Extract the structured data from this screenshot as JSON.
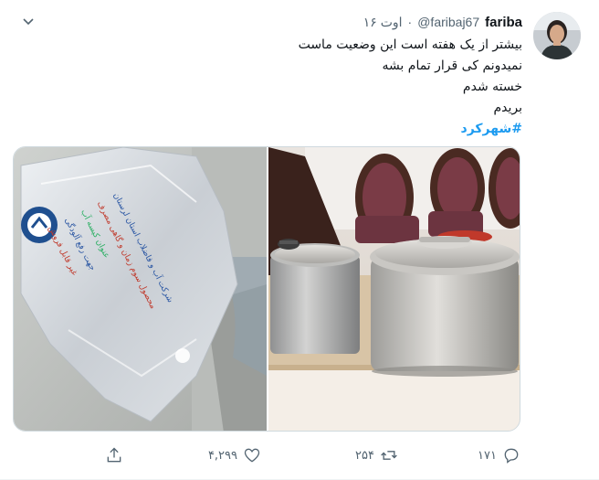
{
  "author": {
    "display_name": "fariba",
    "handle": "@faribaj67",
    "separator": "·",
    "date": "۱۶ اوت"
  },
  "tweet": {
    "lines": [
      "بیشتر از یک هفته است این وضعیت ماست",
      "نمیدونم کی قرار تمام بشه",
      "خسته شدم",
      "بریدم"
    ],
    "hashtag": "#شهرکرد"
  },
  "media": {
    "left_image": "water-bag-photo",
    "right_image": "cooking-pots-photo",
    "bag_text_lines": [
      "شرکت آب و فاضلاب استان لرستان",
      "محصول سوم زمان و گاهی مصرف",
      "عنوان کیسه آب",
      "جهت رفع آلودگی",
      "غیر قابل فروش"
    ]
  },
  "actions": {
    "reply_count": "۱۷۱",
    "retweet_count": "۲۵۴",
    "like_count": "۴,۲۹۹",
    "reply_icon": "reply-icon",
    "retweet_icon": "retweet-icon",
    "like_icon": "heart-icon",
    "share_icon": "share-icon"
  },
  "colors": {
    "hashtag": "#1d9bf0",
    "secondary_text": "#536471"
  }
}
